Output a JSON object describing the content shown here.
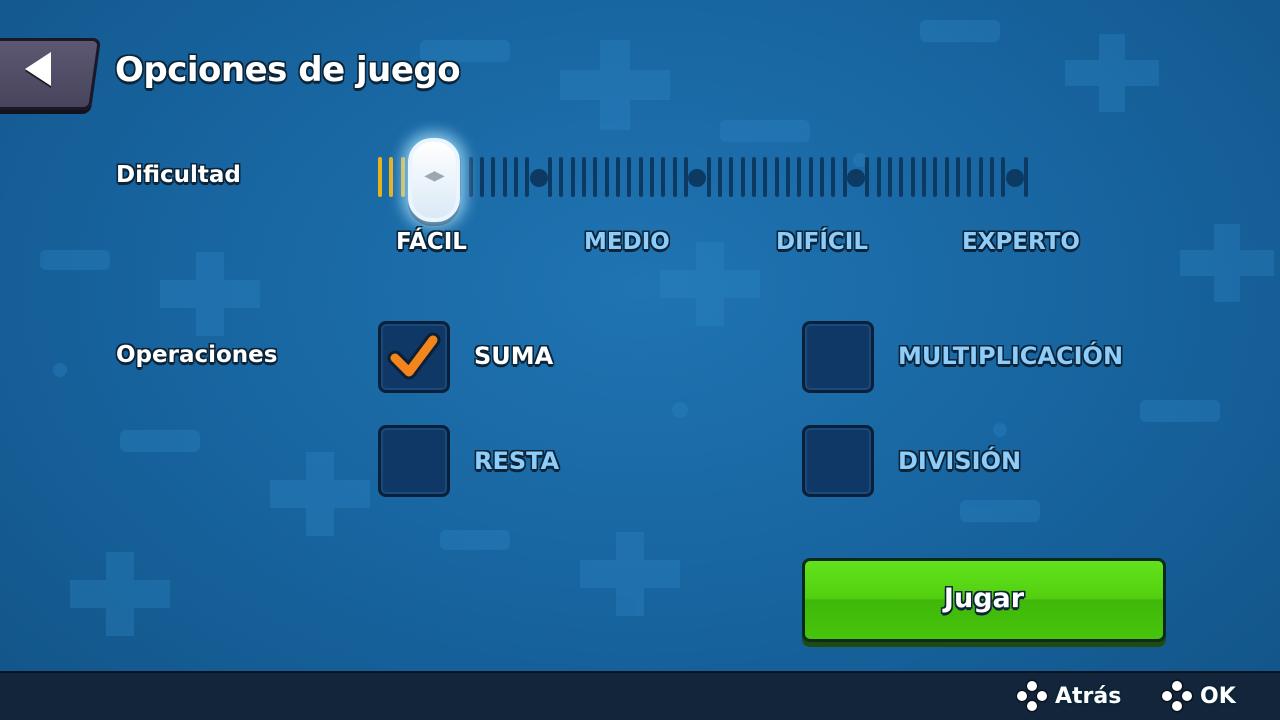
{
  "header": {
    "title": "Opciones de juego",
    "back_icon": "arrow-left-icon"
  },
  "difficulty": {
    "label": "Dificultad",
    "levels": [
      "FÁCIL",
      "MEDIO",
      "DIFÍCIL",
      "EXPERTO"
    ],
    "selected": "FÁCIL",
    "slider_value": 0.02,
    "active_color": "#e8b21c"
  },
  "operations": {
    "label": "Operaciones",
    "items": [
      {
        "label": "SUMA",
        "checked": true
      },
      {
        "label": "MULTIPLICACIÓN",
        "checked": false
      },
      {
        "label": "RESTA",
        "checked": false
      },
      {
        "label": "DIVISIÓN",
        "checked": false
      }
    ],
    "check_color": "#f4841c"
  },
  "play_button": {
    "label": "Jugar",
    "color": "#52d00f"
  },
  "bottom_bar": {
    "hints": [
      {
        "icon": "gamepad-buttons-icon",
        "label": "Atrás"
      },
      {
        "icon": "gamepad-buttons-icon",
        "label": "OK"
      }
    ]
  }
}
